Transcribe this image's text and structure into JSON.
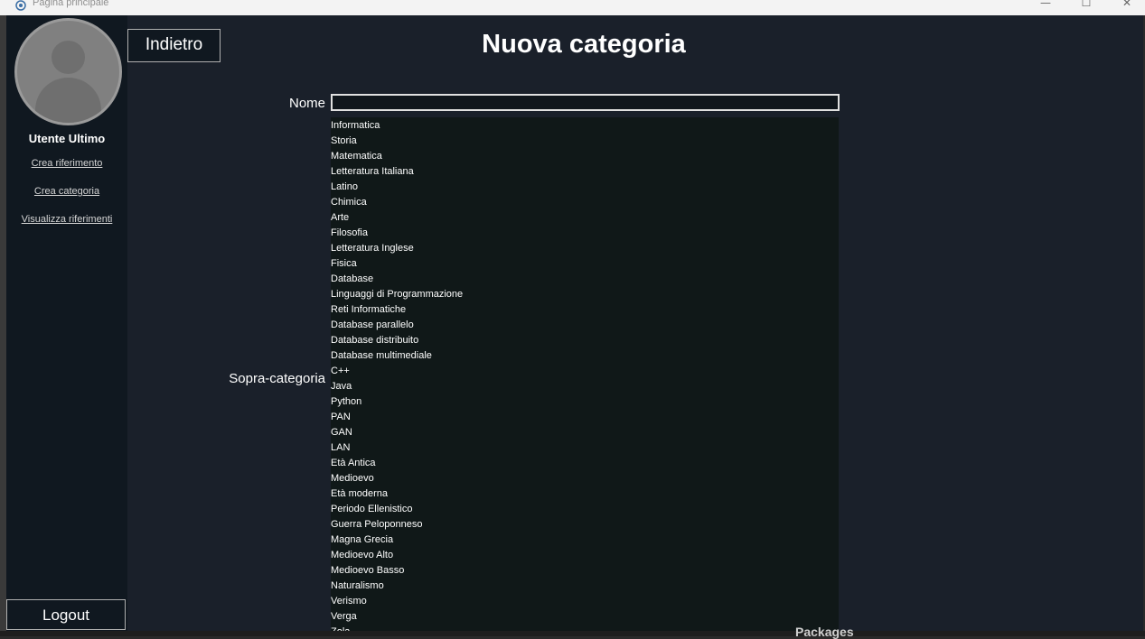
{
  "window": {
    "title": "Pagina principale",
    "minimize": "—",
    "maximize": "☐",
    "close": "✕"
  },
  "sidebar": {
    "user_name": "Utente Ultimo",
    "links": [
      "Crea riferimento",
      "Crea categoria",
      "Visualizza riferimenti"
    ],
    "logout": "Logout"
  },
  "header": {
    "back": "Indietro",
    "title": "Nuova categoria"
  },
  "form": {
    "name_label": "Nome",
    "name_value": "",
    "parent_label": "Sopra-categoria",
    "categories": [
      "Informatica",
      "Storia",
      "Matematica",
      "Letteratura Italiana",
      "Latino",
      "Chimica",
      "Arte",
      "Filosofia",
      "Letteratura Inglese",
      "Fisica",
      "Database",
      "Linguaggi di Programmazione",
      "Reti Informatiche",
      "Database parallelo",
      "Database distribuito",
      "Database multimediale",
      "C++",
      "Java",
      "Python",
      "PAN",
      "GAN",
      "LAN",
      "Età Antica",
      "Medioevo",
      "Età moderna",
      "Periodo Ellenistico",
      "Guerra Peloponneso",
      "Magna Grecia",
      "Medioevo Alto",
      "Medioevo Basso",
      "Naturalismo",
      "Verismo",
      "Verga",
      "Zola"
    ]
  },
  "background": {
    "packages_text": "Packages"
  },
  "colors": {
    "app_bg": "#1a202a",
    "sidebar_bg": "#101820",
    "list_bg": "#101818",
    "text": "#ffffff"
  }
}
